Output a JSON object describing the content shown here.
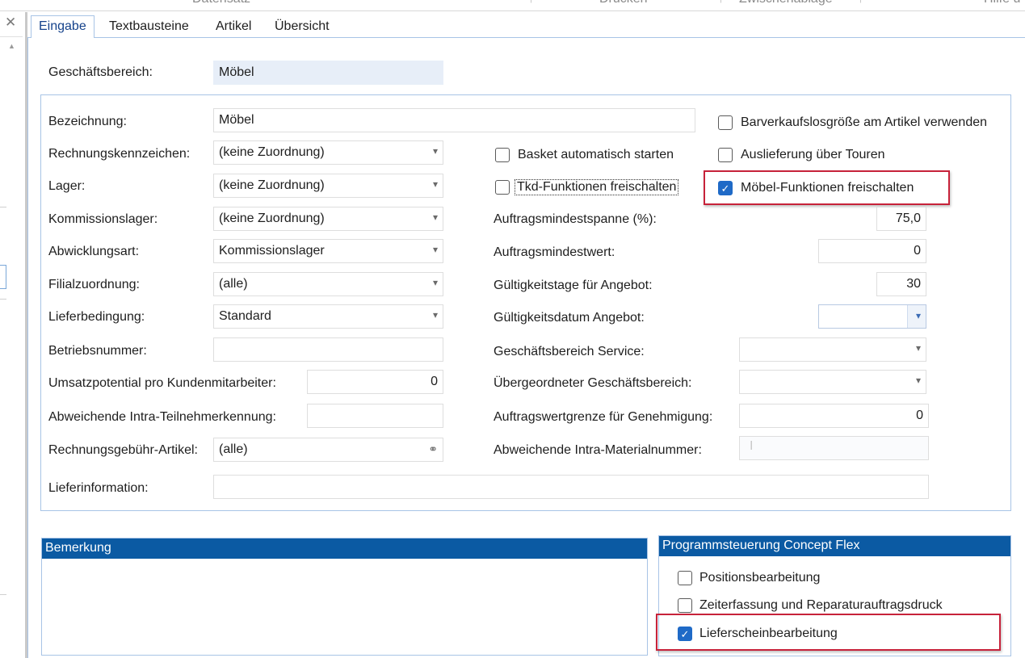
{
  "ribbon": {
    "groups": [
      "Datensatz",
      "Drucken",
      "Zwischenablage",
      "Hilfe u"
    ]
  },
  "left_pane": {
    "close_glyph": "✕",
    "scroll_up_glyph": "▲"
  },
  "tabs": [
    {
      "label": "Eingabe",
      "active": true
    },
    {
      "label": "Textbausteine",
      "active": false
    },
    {
      "label": "Artikel",
      "active": false
    },
    {
      "label": "Übersicht",
      "active": false
    }
  ],
  "top": {
    "geschaeftsbereich_label": "Geschäftsbereich:",
    "geschaeftsbereich_value": "Möbel"
  },
  "left_fields": {
    "bezeichnung": {
      "label": "Bezeichnung:",
      "value": "Möbel"
    },
    "rechnungskennzeichen": {
      "label": "Rechnungskennzeichen:",
      "value": "(keine Zuordnung)"
    },
    "lager": {
      "label": "Lager:",
      "value": "(keine Zuordnung)"
    },
    "kommissionslager": {
      "label": "Kommissionslager:",
      "value": "(keine Zuordnung)"
    },
    "abwicklungsart": {
      "label": "Abwicklungsart:",
      "value": "Kommissionslager"
    },
    "filialzuordnung": {
      "label": "Filialzuordnung:",
      "value": "(alle)"
    },
    "lieferbedingung": {
      "label": "Lieferbedingung:",
      "value": "Standard"
    },
    "betriebsnummer": {
      "label": "Betriebsnummer:",
      "value": ""
    },
    "umsatzpotential": {
      "label": "Umsatzpotential pro Kundenmitarbeiter:",
      "value": "0"
    },
    "intra_teilnehmer": {
      "label": "Abweichende Intra-Teilnehmerkennung:",
      "value": ""
    },
    "rechnungsgebuehr": {
      "label": "Rechnungsgebühr-Artikel:",
      "value": "(alle)"
    },
    "lieferinformation": {
      "label": "Lieferinformation:",
      "value": ""
    }
  },
  "checkboxes": {
    "basket": {
      "label": "Basket automatisch starten",
      "checked": false
    },
    "tkd": {
      "label": "Tkd-Funktionen freischalten",
      "checked": false
    },
    "barverkauf": {
      "label": "Barverkaufslosgröße am Artikel verwenden",
      "checked": false
    },
    "auslieferung": {
      "label": "Auslieferung über Touren",
      "checked": false
    },
    "moebel": {
      "label": "Möbel-Funktionen freischalten",
      "checked": true
    }
  },
  "right_fields": {
    "mindestspanne": {
      "label": "Auftragsmindestspanne (%):",
      "value": "75,0"
    },
    "mindestwert": {
      "label": "Auftragsmindestwert:",
      "value": "0"
    },
    "gueltigkeitstage": {
      "label": "Gültigkeitstage für Angebot:",
      "value": "30"
    },
    "gueltigkeitsdatum": {
      "label": "Gültigkeitsdatum Angebot:",
      "value": ""
    },
    "gb_service": {
      "label": "Geschäftsbereich Service:",
      "value": ""
    },
    "gb_uebergeordnet": {
      "label": "Übergeordneter Geschäftsbereich:",
      "value": ""
    },
    "wertgrenze": {
      "label": "Auftragswertgrenze für Genehmigung:",
      "value": "0"
    },
    "intra_material": {
      "label": "Abweichende Intra-Materialnummer:",
      "value": ""
    }
  },
  "bemerkung": {
    "title": "Bemerkung",
    "text": ""
  },
  "concept_flex": {
    "title": "Programmsteuerung Concept Flex",
    "items": [
      {
        "label": "Positionsbearbeitung",
        "checked": false
      },
      {
        "label": "Zeiterfassung und Reparaturauftragsdruck",
        "checked": false
      },
      {
        "label": "Lieferscheinbearbeitung",
        "checked": true
      }
    ]
  },
  "glyphs": {
    "check": "✓",
    "combo_arrow": "▾",
    "binoculars": "⚭",
    "ibeam": "I",
    "arrow_up": "↑"
  },
  "colors": {
    "accent": "#0b5aa3",
    "highlight_red": "#c7223a",
    "check_blue": "#1f6ac7",
    "readonly_bg": "#e7eef8"
  }
}
